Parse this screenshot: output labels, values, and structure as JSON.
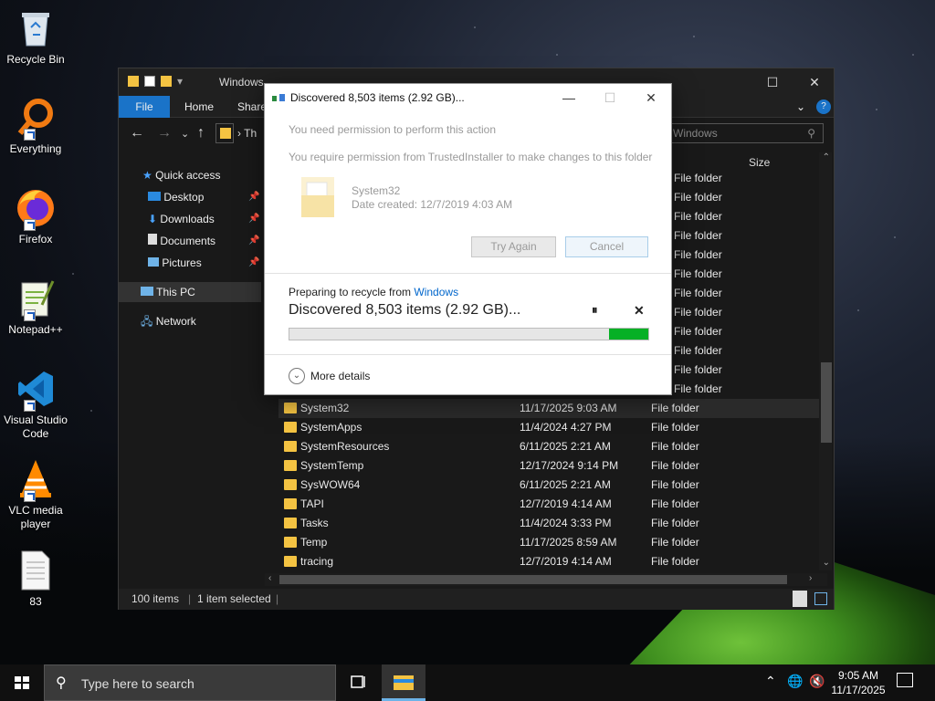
{
  "desktop": {
    "icons": [
      {
        "label": "Recycle Bin",
        "icon": "recycle-bin-icon"
      },
      {
        "label": "Everything",
        "icon": "everything-search-icon"
      },
      {
        "label": "Firefox",
        "icon": "firefox-icon"
      },
      {
        "label": "Notepad++",
        "icon": "notepad-plus-plus-icon"
      },
      {
        "label": "Visual Studio Code",
        "icon": "vscode-icon"
      },
      {
        "label": "VLC media player",
        "icon": "vlc-icon"
      },
      {
        "label": "83",
        "icon": "text-file-icon"
      }
    ]
  },
  "explorer": {
    "title": "Windows",
    "tabs": {
      "file": "File",
      "home": "Home",
      "share": "Share"
    },
    "address_crumb": "Th",
    "search_placeholder": "h Windows",
    "sidebar": {
      "quick_access": "Quick access",
      "desktop": "Desktop",
      "downloads": "Downloads",
      "documents": "Documents",
      "pictures": "Pictures",
      "this_pc": "This PC",
      "network": "Network"
    },
    "columns": {
      "size": "Size"
    },
    "hidden_row_type": "File folder",
    "rows": [
      {
        "name": "System32",
        "date": "11/17/2025 9:03 AM",
        "type": "File folder",
        "selected": true
      },
      {
        "name": "SystemApps",
        "date": "11/4/2024 4:27 PM",
        "type": "File folder"
      },
      {
        "name": "SystemResources",
        "date": "6/11/2025 2:21 AM",
        "type": "File folder"
      },
      {
        "name": "SystemTemp",
        "date": "12/17/2024 9:14 PM",
        "type": "File folder"
      },
      {
        "name": "SysWOW64",
        "date": "6/11/2025 2:21 AM",
        "type": "File folder"
      },
      {
        "name": "TAPI",
        "date": "12/7/2019 4:14 AM",
        "type": "File folder"
      },
      {
        "name": "Tasks",
        "date": "11/4/2024 3:33 PM",
        "type": "File folder"
      },
      {
        "name": "Temp",
        "date": "11/17/2025 8:59 AM",
        "type": "File folder"
      },
      {
        "name": "tracing",
        "date": "12/7/2019 4:14 AM",
        "type": "File folder"
      }
    ],
    "status": {
      "count": "100 items",
      "selected": "1 item selected"
    }
  },
  "dialog": {
    "title": "Discovered 8,503 items (2.92 GB)...",
    "permission_heading": "You need permission to perform this action",
    "permission_detail": "You require permission from TrustedInstaller to make changes to this folder",
    "item_name": "System32",
    "item_date": "Date created: 12/7/2019 4:03 AM",
    "try_again": "Try Again",
    "cancel": "Cancel",
    "preparing_prefix": "Preparing to recycle from ",
    "preparing_source": "Windows",
    "progress_text": "Discovered 8,503 items (2.92 GB)...",
    "progress_fraction": 0.89,
    "more_details": "More details",
    "accent_link": "#0066cc",
    "progress_color": "#06b025"
  },
  "taskbar": {
    "search_placeholder": "Type here to search",
    "time": "9:05 AM",
    "date": "11/17/2025"
  }
}
